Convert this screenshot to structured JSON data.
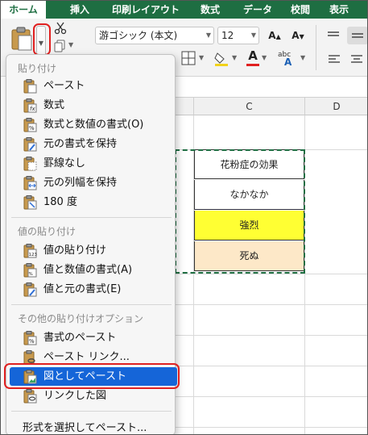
{
  "tabs": [
    "ホーム",
    "挿入",
    "印刷レイアウト",
    "数式",
    "データ",
    "校閲",
    "表示"
  ],
  "ribbon": {
    "font_name": "游ゴシック (本文)",
    "font_size": "12",
    "grow_font": "A",
    "shrink_font": "A",
    "font_color_letter": "A",
    "abc_label": "abc"
  },
  "columns": [
    "C",
    "D"
  ],
  "cells": [
    "花粉症の効果",
    "なかなか",
    "強烈",
    "死ぬ"
  ],
  "colors": {
    "brand": "#1e6e42",
    "highlight_red": "#e02020",
    "selected_blue": "#1565d8",
    "cell_yellow": "#ffff33",
    "cell_peach": "#fde8c8"
  },
  "menu": {
    "section_paste": "貼り付け",
    "section_values": "値の貼り付け",
    "section_other": "その他の貼り付けオプション",
    "items_paste": [
      "ペースト",
      "数式",
      "数式と数値の書式(O)",
      "元の書式を保持",
      "罫線なし",
      "元の列幅を保持",
      "180 度"
    ],
    "items_values": [
      "値の貼り付け",
      "値と数値の書式(A)",
      "値と元の書式(E)"
    ],
    "items_other": [
      "書式のペースト",
      "ペースト リンク...",
      "図としてペースト",
      "リンクした図"
    ],
    "more": "形式を選択してペースト..."
  }
}
